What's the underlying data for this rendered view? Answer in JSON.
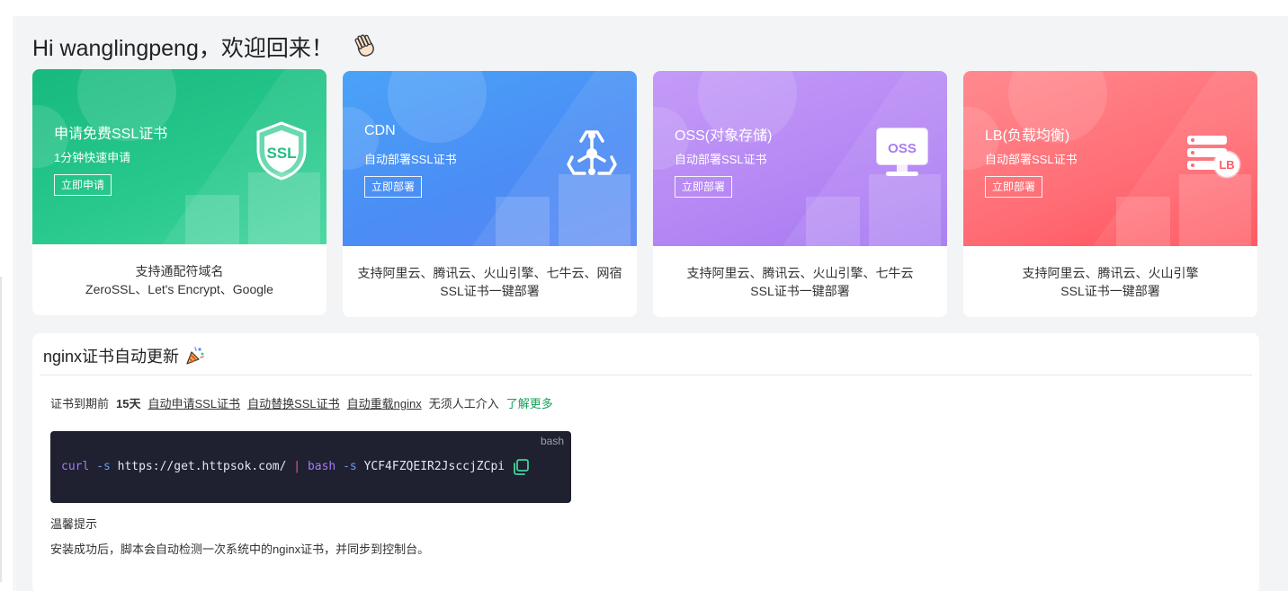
{
  "greeting": "Hi wanglingpeng，欢迎回来！",
  "cards": [
    {
      "title": "申请免费SSL证书",
      "subtitle": "1分钟快速申请",
      "button": "立即申请",
      "icon_text": "SSL",
      "icon": "shield-ssl-icon",
      "foot_line1": "支持通配符域名",
      "foot_line2": "ZeroSSL、Let's Encrypt、Google"
    },
    {
      "title": "CDN",
      "subtitle": "自动部署SSL证书",
      "button": "立即部署",
      "icon": "network-nodes-icon",
      "foot_line1": "支持阿里云、腾讯云、火山引擎、七牛云、网宿",
      "foot_line2": "SSL证书一键部署"
    },
    {
      "title": "OSS(对象存储)",
      "subtitle": "自动部署SSL证书",
      "button": "立即部署",
      "icon_text": "OSS",
      "icon": "monitor-oss-icon",
      "foot_line1": "支持阿里云、腾讯云、火山引擎、七牛云",
      "foot_line2": "SSL证书一键部署"
    },
    {
      "title": "LB(负载均衡)",
      "subtitle": "自动部署SSL证书",
      "button": "立即部署",
      "icon_text": "LB",
      "icon": "server-lb-icon",
      "foot_line1": "支持阿里云、腾讯云、火山引擎",
      "foot_line2": "SSL证书一键部署"
    }
  ],
  "nginx": {
    "title": "nginx证书自动更新",
    "desc_prefix": "证书到期前",
    "days": "15天",
    "link1": "自动申请SSL证书",
    "link2": "自动替换SSL证书",
    "link3": "自动重载nginx",
    "desc_suffix": "无须人工介入",
    "learn_more": "了解更多",
    "code_lang": "bash",
    "code": {
      "cmd1": "curl",
      "flag1": "-s",
      "url": "https://get.httpsok.com/",
      "pipe": "|",
      "cmd2": "bash",
      "flag2": "-s",
      "token": "YCF4FZQEIR2JsccjZCpi"
    },
    "tip_title": "温馨提示",
    "tip_text": "安装成功后，脚本会自动检测一次系统中的nginx证书，并同步到控制台。"
  },
  "colors": {
    "green": "#29c98d",
    "blue": "#4b8cf5",
    "purple": "#b486f4",
    "red": "#ff6c74",
    "link_green": "#18a058",
    "code_bg": "#1f2030"
  }
}
